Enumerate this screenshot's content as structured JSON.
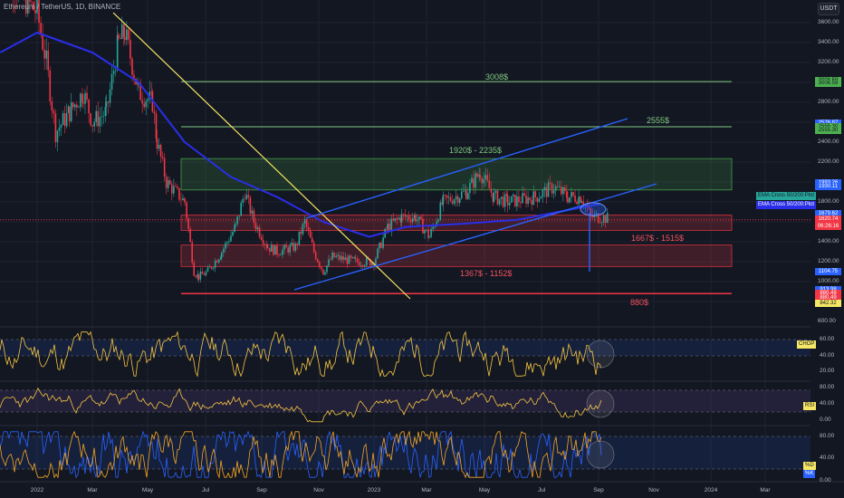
{
  "header": {
    "title": "Ethereum / TetherUS, 1D, BINANCE",
    "currency": "USDT"
  },
  "price_axis": [
    "3600.00",
    "3400.00",
    "3200.00",
    "2800.00",
    "2400.00",
    "2200.00",
    "1800.00",
    "1400.00",
    "1200.00",
    "1000.00",
    "600.00"
  ],
  "badges": [
    {
      "text": "3008.59",
      "color": "#4caf50",
      "price": 3020
    },
    {
      "text": "3008.59",
      "color": "#4caf50",
      "price": 2990
    },
    {
      "text": "2576.87",
      "color": "#2962ff",
      "price": 2590
    },
    {
      "text": "2555.30",
      "color": "#4caf50",
      "price": 2555
    },
    {
      "text": "2555.30",
      "color": "#4caf50",
      "price": 2520
    },
    {
      "text": "1993.26",
      "color": "#2962ff",
      "price": 1990
    },
    {
      "text": "1930.11",
      "color": "#2962ff",
      "price": 1955
    },
    {
      "text": "1679.62",
      "color": "#2962ff",
      "price": 1680
    },
    {
      "text": "1620.74",
      "color": "#f23645",
      "price": 1630
    },
    {
      "text": "06:26:16",
      "color": "#f23645",
      "price": 1555
    },
    {
      "text": "1104.75",
      "color": "#2962ff",
      "price": 1100
    },
    {
      "text": "913.98",
      "color": "#2962ff",
      "price": 920
    },
    {
      "text": "880.49",
      "color": "#f23645",
      "price": 880
    },
    {
      "text": "880.49",
      "color": "#f23645",
      "price": 840
    },
    {
      "text": "842.32",
      "color": "#f5e663",
      "price": 780
    }
  ],
  "ema_tags": [
    "EMA Cross 50/200:Plot",
    "EMA Cross 50/200:Plot"
  ],
  "indicators": [
    {
      "name": "CHOP",
      "ticks": [
        "60.00",
        "40.00",
        "20.00"
      ]
    },
    {
      "name": "RSI",
      "ticks": [
        "80.00",
        "40.00",
        "0.00"
      ]
    },
    {
      "name": "Stoch",
      "ticks": [
        "80.00",
        "40.00",
        "0.00"
      ],
      "tags": [
        "%D",
        "%K"
      ]
    }
  ],
  "time_axis": [
    "2022",
    "Mar",
    "May",
    "Jul",
    "Sep",
    "Nov",
    "2023",
    "Mar",
    "May",
    "Jul",
    "Sep",
    "Nov",
    "2024",
    "Mar"
  ],
  "annotations": {
    "l3008": "3008$",
    "l2555": "2555$",
    "zone_green": "1920$ - 2235$",
    "zone_red1": "1667$ - 1515$",
    "zone_red2": "1367$ - 1152$",
    "l880": "880$"
  },
  "colors": {
    "up": "#26a69a",
    "down": "#f23645",
    "ema": "#2a2ee8",
    "trend": "#f5e663",
    "channel": "#2962ff"
  },
  "chart_data": {
    "type": "candlestick",
    "title": "Ethereum / TetherUS, 1D, BINANCE",
    "ylim": [
      600,
      3800
    ],
    "price_days_since_2022": [
      -40,
      -20,
      0,
      10,
      20,
      35,
      50,
      60,
      75,
      88,
      95,
      110,
      125,
      130,
      140,
      150,
      160,
      170,
      175,
      185,
      200,
      215,
      225,
      235,
      250,
      260,
      280,
      290,
      300,
      310,
      320,
      345,
      365,
      380,
      395,
      410,
      425,
      440,
      465,
      480,
      495,
      510,
      540,
      560,
      575,
      590,
      600,
      610,
      620
    ],
    "close": [
      4200,
      3900,
      3700,
      3200,
      2500,
      2700,
      2900,
      2600,
      2700,
      3400,
      3500,
      2900,
      2800,
      2400,
      2000,
      1900,
      1800,
      1100,
      1050,
      1100,
      1300,
      1550,
      1900,
      1600,
      1350,
      1300,
      1350,
      1600,
      1300,
      1100,
      1250,
      1200,
      1200,
      1550,
      1650,
      1650,
      1450,
      1800,
      1900,
      2100,
      1850,
      1800,
      1850,
      1950,
      1850,
      1850,
      1650,
      1650,
      1630
    ],
    "ema_days": [
      -40,
      0,
      60,
      110,
      160,
      210,
      260,
      310,
      360,
      400,
      460,
      520,
      610
    ],
    "ema": [
      3300,
      3500,
      3300,
      3000,
      2400,
      2050,
      1850,
      1600,
      1450,
      1550,
      1580,
      1620,
      1780
    ]
  }
}
